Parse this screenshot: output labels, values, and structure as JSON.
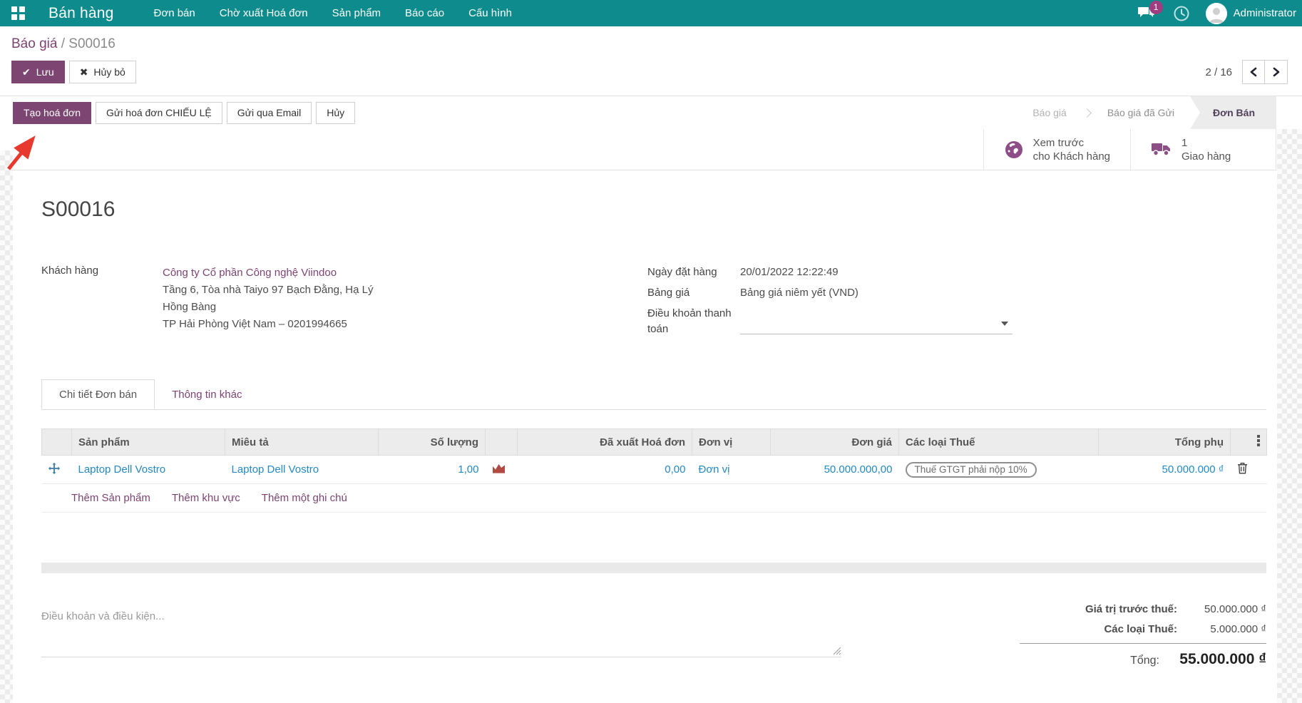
{
  "navbar": {
    "app_title": "Bán hàng",
    "menu_items": [
      "Đơn bán",
      "Chờ xuất Hoá đơn",
      "Sản phẩm",
      "Báo cáo",
      "Cấu hình"
    ],
    "message_count": "1",
    "user_name": "Administrator"
  },
  "breadcrumb": {
    "parent": "Báo giá",
    "separator": "/",
    "current": "S00016"
  },
  "control_panel": {
    "save": "Lưu",
    "discard": "Hủy bỏ",
    "pager": "2 / 16"
  },
  "action_bar": {
    "create_invoice": "Tạo hoá đơn",
    "send_proforma": "Gửi hoá đơn CHIẾU LỆ",
    "send_email": "Gửi qua Email",
    "cancel": "Hủy",
    "status_steps": [
      "Báo giá",
      "Báo giá đã Gửi",
      "Đơn Bán"
    ],
    "active_step": "Đơn Bán"
  },
  "smart_buttons": {
    "preview": {
      "icon": "globe-icon",
      "line1": "Xem trước",
      "line2": "cho Khách hàng"
    },
    "delivery": {
      "icon": "truck-icon",
      "line1": "1",
      "line2": "Giao hàng"
    }
  },
  "sheet": {
    "title": "S00016",
    "customer": {
      "label": "Khách hàng",
      "name": "Công ty Cổ phần Công nghệ Viindoo",
      "address_line1": "Tầng 6, Tòa nhà Taiyo 97 Bạch Đằng, Hạ Lý",
      "address_line2": "Hồng Bàng",
      "address_line3": "TP Hải Phòng Việt Nam – 0201994665"
    },
    "order_info": {
      "date_label": "Ngày đặt hàng",
      "date_value": "20/01/2022 12:22:49",
      "pricelist_label": "Bảng giá",
      "pricelist_value": "Bảng giá niêm yết (VND)",
      "payment_terms_label": "Điều khoản thanh toán",
      "payment_terms_value": ""
    },
    "tabs": {
      "details": "Chi tiết Đơn bán",
      "other": "Thông tin khác"
    },
    "order_lines": {
      "headers": {
        "product": "Sản phẩm",
        "description": "Miêu tả",
        "quantity": "Số lượng",
        "invoiced": "Đã xuất Hoá đơn",
        "uom": "Đơn vị",
        "unit_price": "Đơn giá",
        "taxes": "Các loại Thuế",
        "subtotal": "Tổng phụ"
      },
      "rows": [
        {
          "product": "Laptop Dell Vostro",
          "description": "Laptop Dell Vostro",
          "quantity": "1,00",
          "invoiced": "0,00",
          "uom": "Đơn vị",
          "unit_price": "50.000.000,00",
          "taxes": "Thuế GTGT phải nộp 10%",
          "subtotal": "50.000.000 ₫"
        }
      ],
      "add_product": "Thêm Sản phẩm",
      "add_section": "Thêm khu vực",
      "add_note": "Thêm một ghi chú"
    },
    "terms_placeholder": "Điều khoản và điều kiện...",
    "totals": {
      "untaxed_label": "Giá trị trước thuế:",
      "untaxed_value": "50.000.000 ₫",
      "taxes_label": "Các loại Thuế:",
      "taxes_value": "5.000.000 ₫",
      "total_label": "Tổng:",
      "total_value": "55.000.000 ₫"
    }
  },
  "annotation": {
    "red_arrow_target": "Tạo hoá đơn"
  },
  "colors": {
    "topbar": "#0e8c8d",
    "primary_button": "#7d4672",
    "link": "#7d4373",
    "line_text": "#2589c5",
    "badge": "#a03d80",
    "chart_icon": "#b04a42",
    "smart_icon": "#8d4d86",
    "arrow": "#e8392e"
  }
}
